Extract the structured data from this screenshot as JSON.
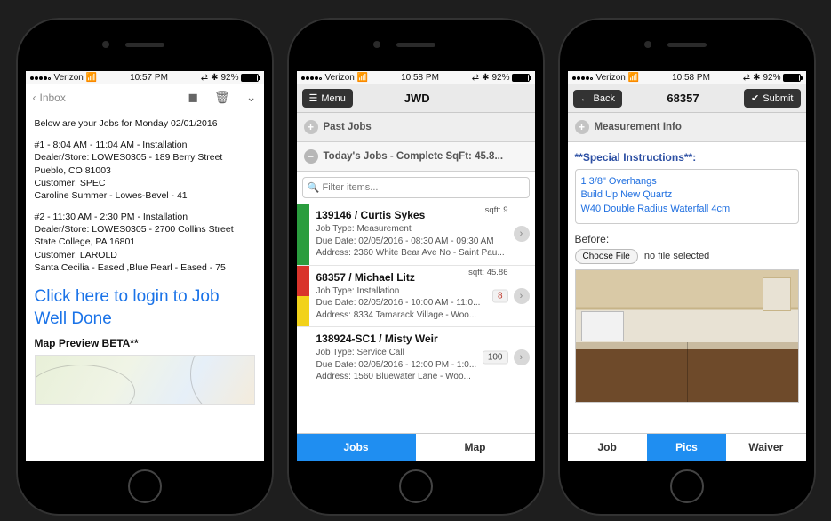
{
  "status": {
    "carrier": "Verizon",
    "time1": "10:57 PM",
    "time2": "10:58 PM",
    "time3": "10:58 PM",
    "battery": "92%",
    "bt": "⁕"
  },
  "p1": {
    "back": "Inbox",
    "intro": "Below are your Jobs for Monday 02/01/2016",
    "j1_l1": "#1 - 8:04 AM - 11:04 AM - Installation",
    "j1_l2": "Dealer/Store: LOWES0305 - 189 Berry Street Pueblo, CO 81003",
    "j1_l3": "Customer: SPEC",
    "j1_l4": "Caroline Summer - Lowes-Bevel - 41",
    "j2_l1": "#2 - 11:30 AM - 2:30 PM - Installation",
    "j2_l2": "Dealer/Store: LOWES0305 - 2700 Collins Street State College, PA 16801",
    "j2_l3": "Customer: LAROLD",
    "j2_l4": "Santa Cecilia - Eased ,Blue Pearl - Eased - 75",
    "login": "Click here to login to Job Well Done",
    "map": "Map Preview BETA**"
  },
  "p2": {
    "menu": "Menu",
    "title": "JWD",
    "past": "Past Jobs",
    "today": "Today's Jobs - Complete SqFt: 45.8...",
    "filter_ph": "Filter items...",
    "jobs": [
      {
        "sqft": "sqft: 9",
        "name": "139146 / Curtis Sykes",
        "type": "Job Type: Measurement",
        "due": "Due Date: 02/05/2016 - 08:30 AM - 09:30 AM",
        "addr": "Address: 2360 White Bear Ave No - Saint Pau..."
      },
      {
        "sqft": "sqft: 45.86",
        "name": "68357 / Michael Litz",
        "type": "Job Type: Installation",
        "badge": "8",
        "due": "Due Date: 02/05/2016 - 10:00 AM - 11:0...",
        "addr": "Address: 8334 Tamarack Village - Woo..."
      },
      {
        "sqft": "",
        "name": "138924-SC1 / Misty Weir",
        "type": "Job Type: Service Call",
        "badge": "100",
        "due": "Due Date: 02/05/2016 - 12:00 PM - 1:0...",
        "addr": "Address: 1560 Bluewater Lane - Woo..."
      }
    ],
    "tab_jobs": "Jobs",
    "tab_map": "Map"
  },
  "p3": {
    "back": "Back",
    "title": "68357",
    "submit": "Submit",
    "section": "Measurement Info",
    "special_label": "**Special Instructions**:",
    "special": [
      "1 3/8\" Overhangs",
      "Build Up New Quartz",
      "W40 Double Radius Waterfall 4cm"
    ],
    "before": "Before:",
    "choose": "Choose File",
    "nofile": "no file selected",
    "tab_job": "Job",
    "tab_pics": "Pics",
    "tab_waiver": "Waiver"
  }
}
